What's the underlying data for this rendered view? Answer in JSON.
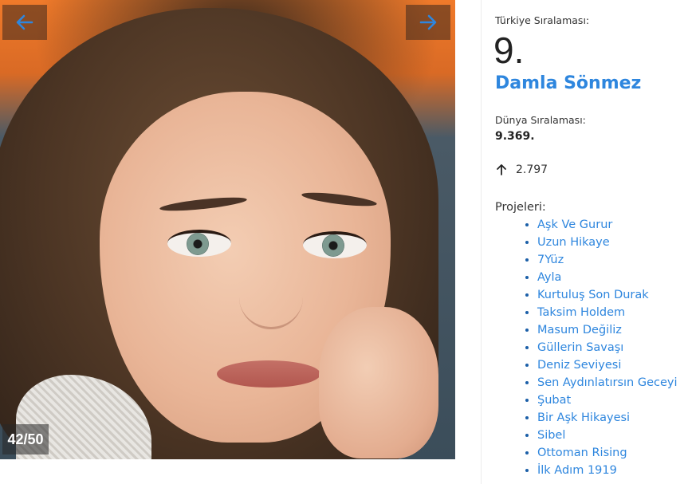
{
  "gallery": {
    "counter": "42/50",
    "prev_icon": "arrow-left-icon",
    "next_icon": "arrow-right-icon",
    "arrow_color": "#2e86de"
  },
  "profile": {
    "turkey_rank_label": "Türkiye Sıralaması:",
    "turkey_rank": "9.",
    "name": "Damla Sönmez",
    "world_rank_label": "Dünya Sıralaması:",
    "world_rank": "9.369.",
    "change_icon": "arrow-up-icon",
    "change_value": "2.797",
    "projects_label": "Projeleri:",
    "projects": [
      "Aşk Ve Gurur",
      "Uzun Hikaye",
      "7Yüz",
      "Ayla",
      "Kurtuluş Son Durak",
      "Taksim Holdem",
      "Masum Değiliz",
      "Güllerin Savaşı",
      "Deniz Seviyesi",
      "Sen Aydınlatırsın Geceyi",
      "Şubat",
      "Bir Aşk Hikayesi",
      "Sibel",
      "Ottoman Rising",
      "İlk Adım 1919"
    ]
  },
  "colors": {
    "accent": "#2e86de",
    "text": "#222222"
  }
}
